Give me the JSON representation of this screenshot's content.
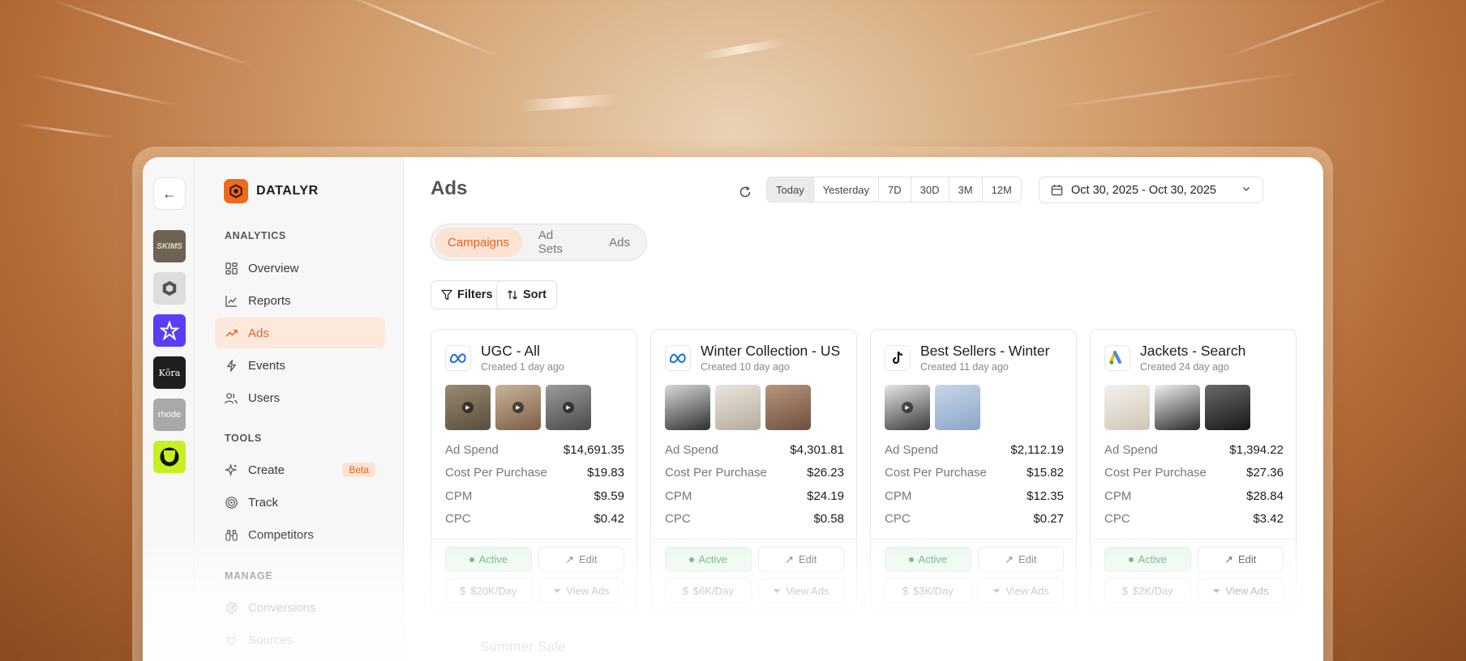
{
  "workspaces": [
    {
      "name": "SKIMS",
      "label": "SKIMS",
      "bg": "#6e6255"
    },
    {
      "name": "hex-brand",
      "label": "",
      "bg": "#dddddd"
    },
    {
      "name": "star-brand",
      "label": "",
      "bg": "#5b3df5"
    },
    {
      "name": "kora",
      "label": "Kōra",
      "bg": "#1f1f1f"
    },
    {
      "name": "rhode",
      "label": "rhode",
      "bg": "#a9a9a9"
    },
    {
      "name": "lime-brand",
      "label": "",
      "bg": "#c7f021"
    }
  ],
  "brand": {
    "name": "DATALYR",
    "accent": "#f06a1c"
  },
  "sidebar": {
    "analytics_label": "ANALYTICS",
    "analytics": [
      {
        "label": "Overview",
        "icon": "grid-icon"
      },
      {
        "label": "Reports",
        "icon": "chart-icon"
      },
      {
        "label": "Ads",
        "icon": "trend-icon"
      },
      {
        "label": "Events",
        "icon": "bolt-icon"
      },
      {
        "label": "Users",
        "icon": "users-icon"
      }
    ],
    "tools_label": "TOOLS",
    "tools": [
      {
        "label": "Create",
        "icon": "sparkle-icon",
        "badge": "Beta"
      },
      {
        "label": "Track",
        "icon": "target-icon"
      },
      {
        "label": "Competitors",
        "icon": "binoculars-icon"
      }
    ],
    "manage_label": "MANAGE",
    "manage": [
      {
        "label": "Conversions",
        "icon": "goal-icon"
      },
      {
        "label": "Sources",
        "icon": "plug-icon"
      }
    ]
  },
  "header": {
    "title": "Ads",
    "ranges": [
      "Today",
      "Yesterday",
      "7D",
      "30D",
      "3M",
      "12M"
    ],
    "selected_range": "Today",
    "date_range": "Oct 30, 2025 - Oct 30, 2025"
  },
  "tabs": [
    "Campaigns",
    "Ad Sets",
    "Ads"
  ],
  "toolbar": {
    "filters": "Filters",
    "sort": "Sort"
  },
  "metric_labels": [
    "Ad Spend",
    "Cost Per Purchase",
    "CPM",
    "CPC"
  ],
  "cards": [
    {
      "title": "UGC - All",
      "created": "Created 1 day ago",
      "platform": "meta-icon",
      "values": [
        "$14,691.35",
        "$19.83",
        "$9.59",
        "$0.42"
      ],
      "status": "Active",
      "edit": "Edit",
      "budget": "$20K/Day",
      "view": "View Ads",
      "thumbs": [
        "#6b5e4a",
        "#8a6e52",
        "#5f5f5f"
      ]
    },
    {
      "title": "Winter Collection - US",
      "created": "Created 10 day ago",
      "platform": "meta-icon",
      "values": [
        "$4,301.81",
        "$26.23",
        "$24.19",
        "$0.58"
      ],
      "status": "Active",
      "edit": "Edit",
      "budget": "$6K/Day",
      "view": "View Ads",
      "thumbs": [
        "#3a3a3a",
        "#d8d2c8",
        "#9a7c63"
      ]
    },
    {
      "title": "Best Sellers - Winter",
      "created": "Created 11 day ago",
      "platform": "tiktok-icon",
      "values": [
        "$2,112.19",
        "$15.82",
        "$12.35",
        "$0.27"
      ],
      "status": "Active",
      "edit": "Edit",
      "budget": "$3K/Day",
      "view": "View Ads",
      "thumbs": [
        "#4a4a4a",
        "#a6bcd8"
      ]
    },
    {
      "title": "Jackets - Search",
      "created": "Created 24 day ago",
      "platform": "google-ads-icon",
      "values": [
        "$1,394.22",
        "$27.36",
        "$28.84",
        "$3.42"
      ],
      "status": "Active",
      "edit": "Edit",
      "budget": "$2K/Day",
      "view": "View Ads",
      "thumbs": [
        "#e9e4dc",
        "#2d2d2d",
        "#1e1e1e"
      ]
    }
  ],
  "next_card_title": "Summer Sale"
}
